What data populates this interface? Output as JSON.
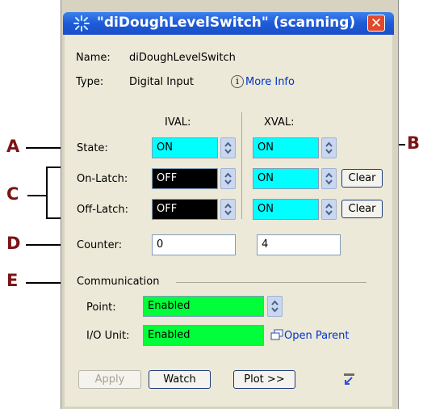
{
  "window": {
    "title": "\"diDoughLevelSwitch\" (scanning)",
    "close_glyph": "✕"
  },
  "info": {
    "name_label": "Name:",
    "name_value": "diDoughLevelSwitch",
    "type_label": "Type:",
    "type_value": "Digital Input",
    "more_info": "More Info"
  },
  "columns": {
    "ival": "IVAL:",
    "xval": "XVAL:"
  },
  "rows": {
    "state": {
      "label": "State:",
      "ival": "ON",
      "xval": "ON"
    },
    "on_latch": {
      "label": "On-Latch:",
      "ival": "OFF",
      "xval": "ON",
      "clear": "Clear"
    },
    "off_latch": {
      "label": "Off-Latch:",
      "ival": "OFF",
      "xval": "ON",
      "clear": "Clear"
    },
    "counter": {
      "label": "Counter:",
      "ival": "0",
      "xval": "4"
    }
  },
  "communication": {
    "heading": "Communication",
    "point_label": "Point:",
    "point_value": "Enabled",
    "io_label": "I/O Unit:",
    "io_value": "Enabled",
    "open_parent": "Open Parent"
  },
  "buttons": {
    "apply": "Apply",
    "watch": "Watch",
    "plot": "Plot >>"
  },
  "callouts": {
    "a": "A",
    "b": "B",
    "c": "C",
    "d": "D",
    "e": "E"
  },
  "colors": {
    "accent_text": "#7b1416",
    "cyan": "#00ffff",
    "green": "#00ff3a",
    "title_blue": "#1f5ad8"
  }
}
